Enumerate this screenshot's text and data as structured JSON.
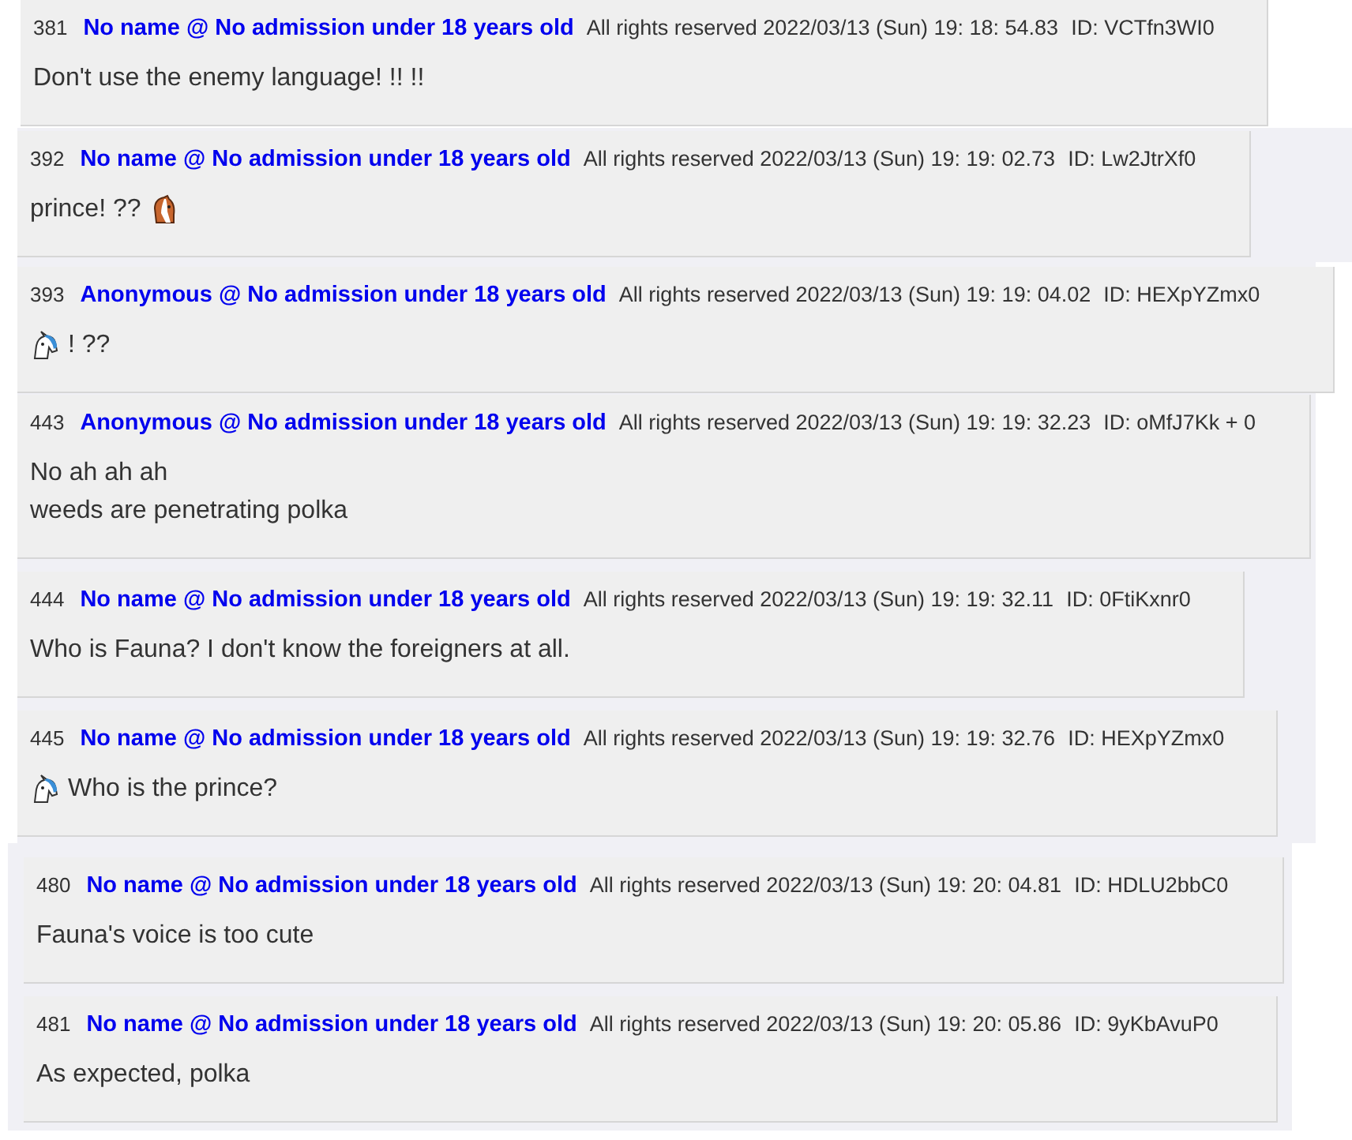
{
  "posts": [
    {
      "number": "381",
      "author": "No name @ No admission under 18 years old",
      "meta": "All rights reserved 2022/03/13 (Sun) 19: 18: 54.83",
      "id": "ID: VCTfn3WI0",
      "lines": [
        {
          "text": "Don't use the enemy language! !! !!"
        }
      ]
    },
    {
      "number": "392",
      "author": "No name @ No admission under 18 years old",
      "meta": "All rights reserved 2022/03/13 (Sun) 19: 19: 02.73",
      "id": "ID: Lw2JtrXf0",
      "lines": [
        {
          "parts": [
            {
              "kind": "text",
              "text": "prince! ??"
            },
            {
              "kind": "horse"
            }
          ]
        }
      ]
    },
    {
      "number": "393",
      "author": "Anonymous @ No admission under 18 years old",
      "meta": "All rights reserved 2022/03/13 (Sun) 19: 19: 04.02",
      "id": "ID: HEXpYZmx0",
      "lines": [
        {
          "parts": [
            {
              "kind": "unicorn"
            },
            {
              "kind": "text",
              "text": "! ??"
            }
          ]
        }
      ]
    },
    {
      "number": "443",
      "author": "Anonymous @ No admission under 18 years old",
      "meta": "All rights reserved 2022/03/13 (Sun) 19: 19: 32.23",
      "id": "ID: oMfJ7Kk + 0",
      "lines": [
        {
          "text": "No ah ah ah"
        },
        {
          "text": "weeds are penetrating polka"
        }
      ]
    },
    {
      "number": "444",
      "author": "No name @ No admission under 18 years old",
      "meta": "All rights reserved 2022/03/13 (Sun) 19: 19: 32.11",
      "id": "ID: 0FtiKxnr0",
      "lines": [
        {
          "text": "Who is Fauna? I don't know the foreigners at all."
        }
      ]
    },
    {
      "number": "445",
      "author": "No name @ No admission under 18 years old",
      "meta": "All rights reserved 2022/03/13 (Sun) 19: 19: 32.76",
      "id": "ID: HEXpYZmx0",
      "lines": [
        {
          "parts": [
            {
              "kind": "unicorn"
            },
            {
              "kind": "text",
              "text": "Who is the prince?"
            }
          ]
        }
      ]
    },
    {
      "number": "480",
      "author": "No name @ No admission under 18 years old",
      "meta": "All rights reserved 2022/03/13 (Sun) 19: 20: 04.81",
      "id": "ID: HDLU2bbC0",
      "lines": [
        {
          "text": "Fauna's voice is too cute"
        }
      ]
    },
    {
      "number": "481",
      "author": "No name @ No admission under 18 years old",
      "meta": "All rights reserved 2022/03/13 (Sun) 19: 20: 05.86",
      "id": "ID: 9yKbAvuP0",
      "lines": [
        {
          "text": "As expected, polka"
        }
      ]
    }
  ]
}
